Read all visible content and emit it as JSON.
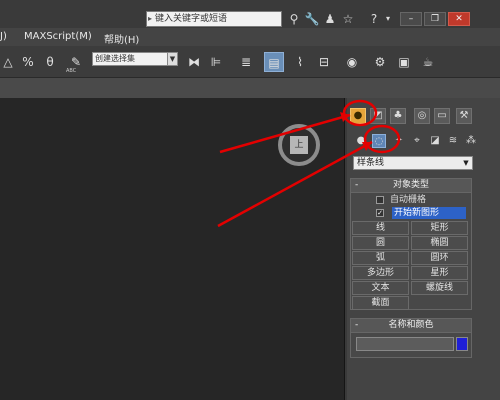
{
  "titlebar": {
    "search_placeholder": "键入关键字或短语",
    "icons": [
      "binoculars-icon",
      "wrench-icon",
      "user-icon",
      "star-icon",
      "help-icon"
    ],
    "window_buttons": [
      "minimize",
      "restore",
      "close"
    ]
  },
  "menu": {
    "items": [
      {
        "label": "J)"
      },
      {
        "label": "MAXScript(M)"
      },
      {
        "label": "帮助(H)"
      }
    ]
  },
  "toolbar": {
    "selection_set_label": "创建选择集",
    "abc_label": "ABC",
    "tools": [
      "snap-icon",
      "percent-snap-icon",
      "spinner-snap-icon",
      "edit-named-selection-icon",
      "mirror-icon",
      "align-icon",
      "layer-manager-icon",
      "graphite-icon",
      "curve-editor-icon",
      "schematic-view-icon",
      "material-editor-icon",
      "render-setup-icon",
      "rendered-frame-icon",
      "render-icon"
    ]
  },
  "viewport": {
    "viewcube_label": "上"
  },
  "command_panel": {
    "tabs": [
      "create",
      "modify",
      "hierarchy",
      "motion",
      "display",
      "utilities"
    ],
    "active_tab": "create",
    "categories": [
      "geometry",
      "shapes",
      "lights",
      "cameras",
      "helpers",
      "space-warps",
      "systems"
    ],
    "active_category": "shapes",
    "category_dropdown": "样条线",
    "object_type": {
      "title": "对象类型",
      "auto_grid": "自动栅格",
      "start_new_shape": "开始新图形",
      "buttons": [
        "线",
        "矩形",
        "圆",
        "椭圆",
        "弧",
        "圆环",
        "多边形",
        "星形",
        "文本",
        "螺旋线",
        "截面"
      ]
    },
    "name_color": {
      "title": "名称和颜色",
      "name_value": "",
      "swatch_color": "#1f1fd6"
    }
  },
  "colors": {
    "accent_orange": "#e6a53a",
    "selection_blue": "#2d62c7",
    "annotation_red": "#e30000"
  }
}
